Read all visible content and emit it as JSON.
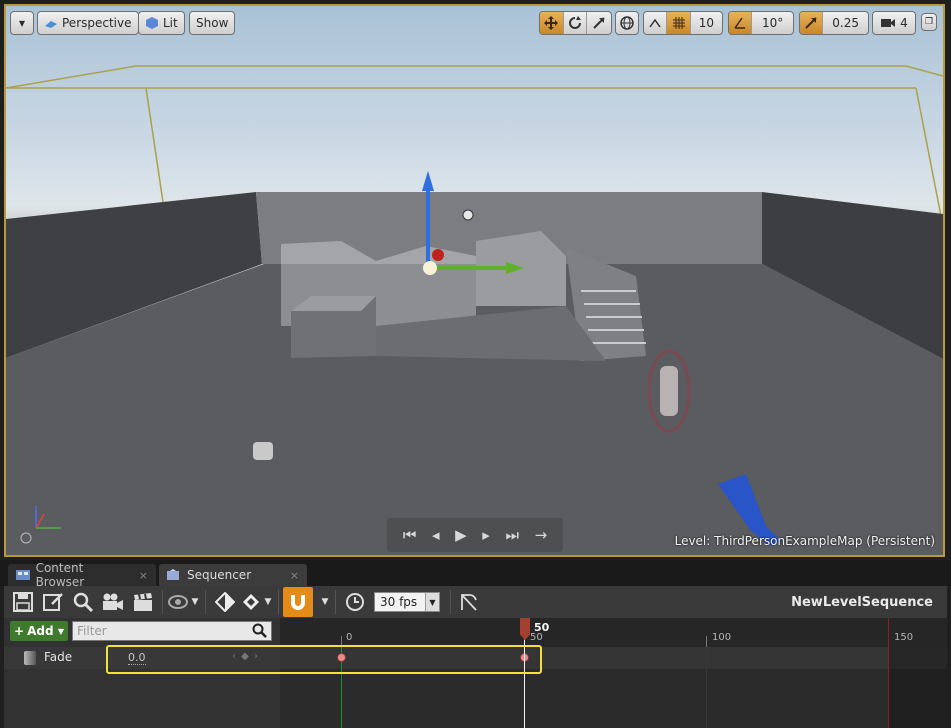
{
  "viewport": {
    "options_caret": "▾",
    "view_mode": "Perspective",
    "lit_mode": "Lit",
    "show_label": "Show",
    "grid_snap_value": "10",
    "rotation_snap_value": "10°",
    "scale_snap_value": "0.25",
    "camera_speed_value": "4",
    "level_prefix": "Level:",
    "level_name": "ThirdPersonExampleMap (Persistent)",
    "playback": [
      "⏮",
      "◂",
      "▶",
      "▸",
      "⏭",
      "→"
    ]
  },
  "tabs": [
    {
      "label": "Content Browser",
      "close": "×"
    },
    {
      "label": "Sequencer",
      "close": "×"
    }
  ],
  "toolbar": {
    "fps": "30 fps",
    "sequence_name": "NewLevelSequence"
  },
  "sequencer": {
    "add_label": "Add",
    "filter_placeholder": "Filter",
    "track_name": "Fade",
    "track_value": "0.0",
    "ruler_ticks": [
      "0",
      "50",
      "100",
      "150"
    ],
    "playhead_frame": "50"
  },
  "colors": {
    "accent_orange": "#e58b17",
    "add_green": "#3f7a2e",
    "selection_yellow": "#f0e040",
    "start_green": "#1f8f2a",
    "end_red": "#8a2020",
    "keyframe": "#ef8a8a"
  }
}
